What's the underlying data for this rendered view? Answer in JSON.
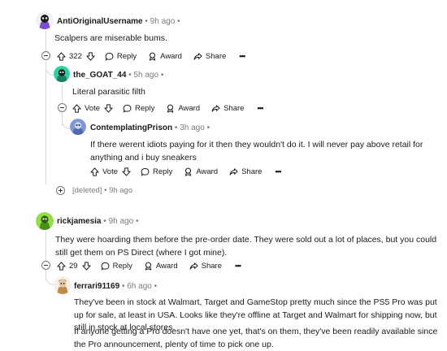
{
  "comments": [
    {
      "username": "AntiOriginalUsername",
      "time": "9h ago",
      "text": "Scalpers are miserable bums.",
      "votes": "322",
      "reply": "Reply",
      "award": "Award",
      "share": "Share"
    },
    {
      "username": "the_GOAT_44",
      "time": "5h ago",
      "text": "Literal parasitic filth",
      "votes": "Vote",
      "reply": "Reply",
      "award": "Award",
      "share": "Share"
    },
    {
      "username": "ContemplatingPrison",
      "time": "3h ago",
      "text": "If there werent idiots paying for it then they wouldn't do it. I will never pay above retail for anything and i buy sneakers",
      "votes": "Vote",
      "reply": "Reply",
      "award": "Award",
      "share": "Share"
    },
    {
      "deleted_label": "[deleted]",
      "time": "9h ago"
    },
    {
      "username": "rickjamesia",
      "time": "9h ago",
      "text": "They were hoarding them before the pre-order date. They were sold out a lot of places, but you could still get them on PS Direct (where I got mine).",
      "votes": "29",
      "reply": "Reply",
      "award": "Award",
      "share": "Share"
    },
    {
      "username": "ferrari91169",
      "time": "6h ago",
      "text": "They've been in stock at Walmart, Target and GameStop pretty much since the PS5 Pro was put up for sale, at least in USA. Looks like they're offline at Target and Walmart for shipping now, but still in stock at local stores.",
      "text2": "If anyone getting a Pro doesn't have one yet, that's on them, they've been readily available since the Pro announcement, plenty of time to pick one up."
    }
  ],
  "separator": "•",
  "more": "•••",
  "colors": {
    "thread": "#d9d9d9",
    "meta": "#7c7c7c",
    "text": "#1a1a1b"
  }
}
